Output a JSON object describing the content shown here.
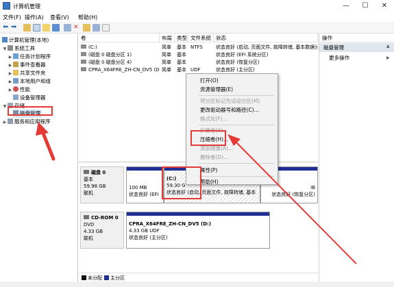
{
  "window": {
    "title": "计算机管理"
  },
  "menu": [
    "文件(F)",
    "操作(A)",
    "查看(V)",
    "帮助(H)"
  ],
  "tree": {
    "root": "计算机管理(本地)",
    "system_tools": "系统工具",
    "task_scheduler": "任务计划程序",
    "event_viewer": "事件查看器",
    "shared_folders": "共享文件夹",
    "local_users": "本地用户和组",
    "performance": "性能",
    "device_manager": "设备管理器",
    "storage": "存储",
    "disk_management": "磁盘管理",
    "services": "服务和应用程序"
  },
  "volumes": {
    "headers": [
      "卷",
      "布局",
      "类型",
      "文件系统",
      "状态"
    ],
    "rows": [
      [
        "(C:)",
        "简单",
        "基本",
        "NTFS",
        "状态良好 (启动, 页面文件, 故障转储, 基本数据分"
      ],
      [
        "(磁盘 0 磁盘分区 1)",
        "简单",
        "基本",
        "",
        "状态良好 (EFI 系统分区)"
      ],
      [
        "(磁盘 0 磁盘分区 4)",
        "简单",
        "基本",
        "",
        "状态良好 (恢复分区)"
      ],
      [
        "CPRA_X64FRE_ZH-CN_DV5 (D:)",
        "简单",
        "基本",
        "UDF",
        "状态良好 (主分区)"
      ]
    ]
  },
  "actions": {
    "header": "操作",
    "section": "磁盘管理",
    "more": "更多操作"
  },
  "disk0": {
    "name": "磁盘 0",
    "type": "基本",
    "size": "59.98 GB",
    "status": "联机",
    "p1_size": "100 MB",
    "p1_status": "状态良好 (EFI",
    "c_name": "(C:)",
    "c_size": "59.30 G",
    "c_status": "状态良好 (启动, 页面文件, 故障转储, 基本",
    "p4_size": "IB",
    "p4_status": "状态良好 (恢复分区)"
  },
  "cdrom": {
    "name": "CD-ROM 0",
    "type": "DVD",
    "size": "4.33 GB",
    "status": "联机",
    "vol_name": "CPRA_X64FRE_ZH-CN_DV5  (D:)",
    "vol_size": "4.33 GB UDF",
    "vol_status": "状态良好 (主分区)"
  },
  "legend": {
    "unallocated": "未分配",
    "primary": "主分区"
  },
  "context_menu": {
    "open": "打开(O)",
    "explore": "资源管理器(E)",
    "mark_active": "将分区标记为活动分区(M)",
    "change_letter": "更改驱动器号和路径(C)...",
    "format": "格式化(F)...",
    "extend": "扩展卷(X)...",
    "shrink": "压缩卷(H)...",
    "add_mirror": "添加镜像(A)...",
    "delete": "删除卷(D)...",
    "properties": "属性(P)",
    "help": "帮助(H)"
  },
  "colors": {
    "partition_bar": "#1f2f94",
    "annotation": "#e53935"
  }
}
